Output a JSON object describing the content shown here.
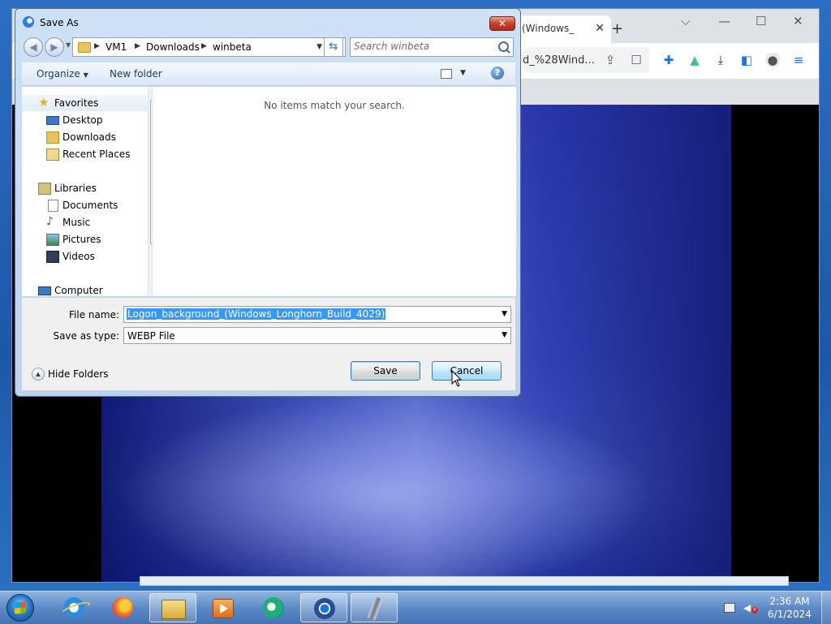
{
  "browser": {
    "tab_title": "(Windows_",
    "tab_close": "✕",
    "new_tab": "+",
    "address_fragment": "d_%28Wind...",
    "window_controls": [
      "⌵",
      "—",
      "☐",
      "✕"
    ]
  },
  "dialog": {
    "title": "Save As",
    "close_label": "✕",
    "breadcrumb": [
      "VM1",
      "Downloads",
      "winbeta"
    ],
    "search_placeholder": "Search winbeta",
    "organize_label": "Organize",
    "new_folder_label": "New folder",
    "help_label": "?",
    "empty_message": "No items match your search.",
    "nav_items": [
      {
        "label": "Favorites",
        "icon": "star-icon"
      },
      {
        "label": "Desktop",
        "icon": "desktop-icon"
      },
      {
        "label": "Downloads",
        "icon": "downloads-folder-icon"
      },
      {
        "label": "Recent Places",
        "icon": "recent-places-icon"
      },
      {
        "label": "Libraries",
        "icon": "libraries-icon"
      },
      {
        "label": "Documents",
        "icon": "documents-icon"
      },
      {
        "label": "Music",
        "icon": "music-icon"
      },
      {
        "label": "Pictures",
        "icon": "pictures-icon"
      },
      {
        "label": "Videos",
        "icon": "videos-icon"
      },
      {
        "label": "Computer",
        "icon": "computer-icon"
      }
    ],
    "file_name_label": "File name:",
    "file_name_value": "Logon_background_(Windows_Longhorn_Build_4029)",
    "save_type_label": "Save as type:",
    "save_type_value": "WEBP File",
    "hide_folders_label": "Hide Folders",
    "save_button": "Save",
    "cancel_button": "Cancel"
  },
  "taskbar": {
    "apps": [
      "internet-explorer",
      "firefox",
      "windows-explorer",
      "media-player",
      "edge",
      "chrome",
      "pen-tool"
    ],
    "active_app": "chrome",
    "time": "2:36 AM",
    "date": "6/1/2024"
  },
  "colors": {
    "selection": "#3399ff",
    "dialog_frame": "#bcd3ee",
    "taskbar": "#5f8cc8"
  }
}
